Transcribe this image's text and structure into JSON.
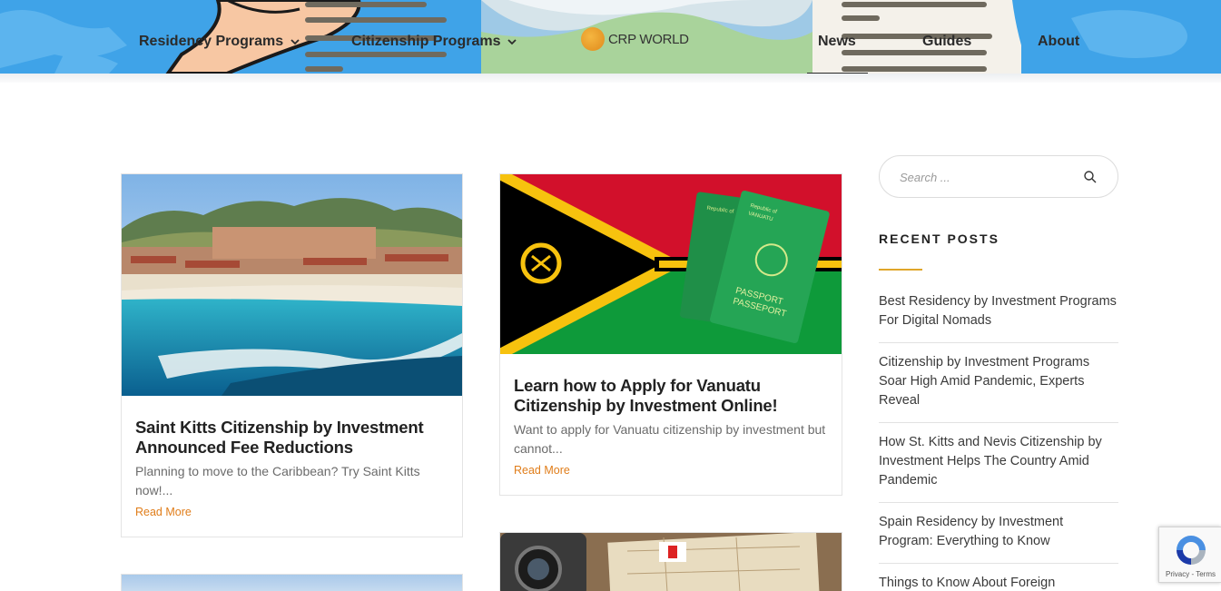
{
  "header": {
    "nav": [
      {
        "label": "Residency Programs",
        "has_dropdown": true
      },
      {
        "label": "Citizenship Programs",
        "has_dropdown": true
      },
      {
        "label": "News",
        "active": true
      },
      {
        "label": "Guides"
      },
      {
        "label": "About"
      }
    ],
    "logo_text": "CRP WORLD"
  },
  "posts": [
    {
      "title": "Saint Kitts Citizenship by Investment Announced Fee Reductions",
      "excerpt": "Planning to move to the Caribbean? Try Saint Kitts now!...",
      "read_more": "Read More"
    },
    {
      "title": "Learn how to Apply for Vanuatu Citizenship by Investment Online!",
      "excerpt": "Want to apply for Vanuatu citizenship by investment but cannot...",
      "read_more": "Read More",
      "passport_text": [
        "Republic of",
        "VANUATU",
        "PASSPORT",
        "PASSEPORT"
      ]
    }
  ],
  "sidebar": {
    "search_placeholder": "Search ...",
    "recent_title": "RECENT POSTS",
    "recent_posts": [
      "Best Residency by Investment Programs For Digital Nomads",
      "Citizenship by Investment Programs Soar High Amid Pandemic, Experts Reveal",
      "How St. Kitts and Nevis Citizenship by Investment Helps The Country Amid Pandemic",
      "Spain Residency by Investment Program: Everything to Know",
      "Things to Know About Foreign"
    ]
  },
  "recaptcha": {
    "links": "Privacy - Terms"
  },
  "colors": {
    "accent": "#e07d1a",
    "widget_accent": "#e0a62a",
    "header_blue": "#3fa3e8"
  }
}
